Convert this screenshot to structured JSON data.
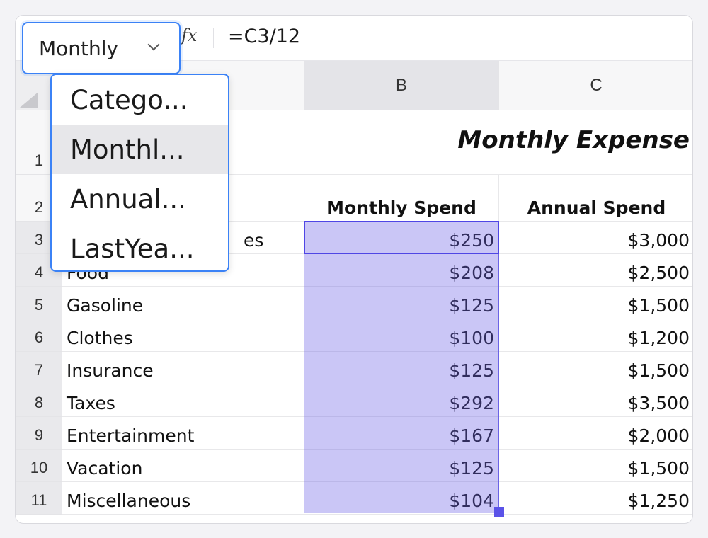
{
  "dropdown": {
    "value": "Monthly",
    "options": [
      "Catego...",
      "Monthl...",
      "Annual...",
      "LastYea..."
    ],
    "highlighted_index": 1
  },
  "formula_bar": {
    "fx_label": "fx",
    "formula": "=C3/12"
  },
  "columns": [
    "B",
    "C"
  ],
  "rows": [
    "1",
    "2",
    "3",
    "4",
    "5",
    "6",
    "7",
    "8",
    "9",
    "10",
    "11"
  ],
  "sheet": {
    "title": "Monthly Expense",
    "headers": {
      "monthly": "Monthly Spend",
      "annual": "Annual Spend"
    },
    "partial_a3": "es",
    "items": [
      {
        "category": "",
        "monthly": "$250",
        "annual": "$3,000"
      },
      {
        "category": "Food",
        "monthly": "$208",
        "annual": "$2,500"
      },
      {
        "category": "Gasoline",
        "monthly": "$125",
        "annual": "$1,500"
      },
      {
        "category": "Clothes",
        "monthly": "$100",
        "annual": "$1,200"
      },
      {
        "category": "Insurance",
        "monthly": "$125",
        "annual": "$1,500"
      },
      {
        "category": "Taxes",
        "monthly": "$292",
        "annual": "$3,500"
      },
      {
        "category": "Entertainment",
        "monthly": "$167",
        "annual": "$2,000"
      },
      {
        "category": "Vacation",
        "monthly": "$125",
        "annual": "$1,500"
      },
      {
        "category": "Miscellaneous",
        "monthly": "$104",
        "annual": "$1,250"
      }
    ]
  },
  "colors": {
    "accent": "#3b82f6",
    "selection": "#6b63e6"
  }
}
